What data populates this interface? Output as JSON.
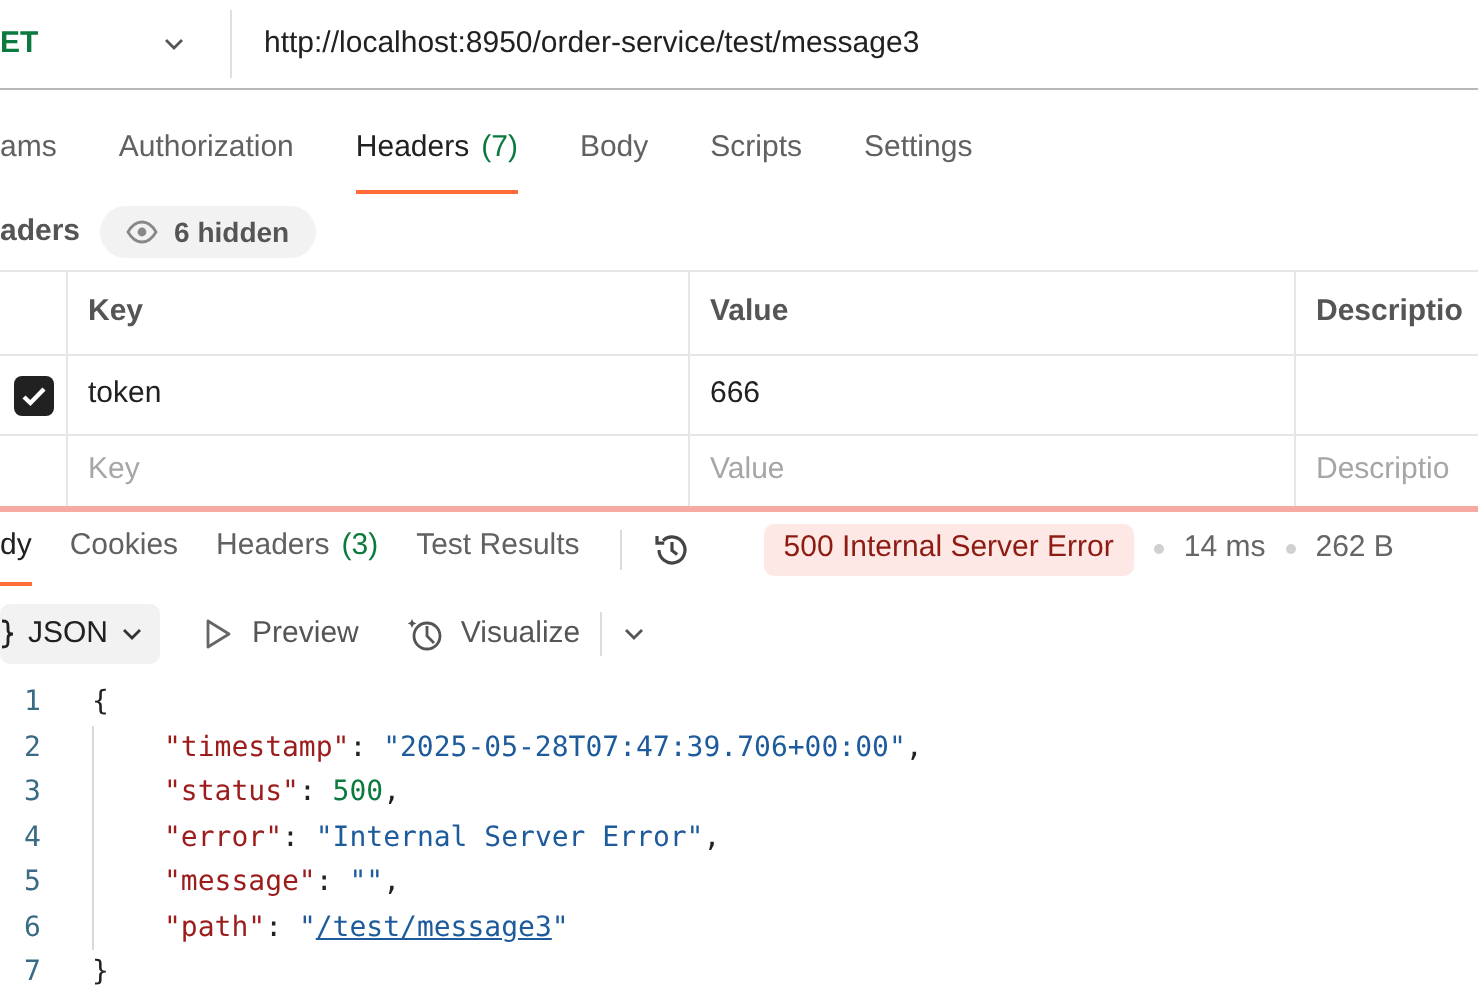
{
  "request": {
    "method": "ET",
    "url": "http://localhost:8950/order-service/test/message3"
  },
  "request_tabs": [
    {
      "label": "ams",
      "selected": false
    },
    {
      "label": "Authorization",
      "selected": false
    },
    {
      "label": "Headers",
      "count": "(7)",
      "selected": true
    },
    {
      "label": "Body",
      "selected": false
    },
    {
      "label": "Scripts",
      "selected": false
    },
    {
      "label": "Settings",
      "selected": false
    }
  ],
  "headers_section": {
    "title": "aders",
    "hidden_toggle": "6 hidden"
  },
  "headers_table": {
    "columns": [
      "Key",
      "Value",
      "Descriptio"
    ],
    "rows": [
      {
        "checked": true,
        "key": "token",
        "value": "666"
      }
    ],
    "new_row": {
      "key_placeholder": "Key",
      "value_placeholder": "Value",
      "description_placeholder": "Descriptio"
    }
  },
  "response_tabs": [
    {
      "label": "dy",
      "selected": true
    },
    {
      "label": "Cookies",
      "selected": false
    },
    {
      "label": "Headers",
      "count": "(3)",
      "selected": false
    },
    {
      "label": "Test Results",
      "selected": false
    }
  ],
  "response_status": {
    "status": "500 Internal Server Error",
    "time": "14 ms",
    "size": "262 B"
  },
  "response_toolbar": {
    "format": "JSON",
    "preview": "Preview",
    "visualize": "Visualize"
  },
  "response_body": [
    {
      "number": "1",
      "tokens": [
        {
          "kind": "punct",
          "text": "{"
        }
      ]
    },
    {
      "number": "2",
      "tokens": [
        {
          "kind": "key",
          "text": "\"timestamp\""
        },
        {
          "kind": "punct",
          "text": ": "
        },
        {
          "kind": "string",
          "text": "\"2025-05-28T07:47:39.706+00:00\""
        },
        {
          "kind": "punct",
          "text": ","
        }
      ]
    },
    {
      "number": "3",
      "tokens": [
        {
          "kind": "key",
          "text": "\"status\""
        },
        {
          "kind": "punct",
          "text": ": "
        },
        {
          "kind": "number",
          "text": "500"
        },
        {
          "kind": "punct",
          "text": ","
        }
      ]
    },
    {
      "number": "4",
      "tokens": [
        {
          "kind": "key",
          "text": "\"error\""
        },
        {
          "kind": "punct",
          "text": ": "
        },
        {
          "kind": "string",
          "text": "\"Internal Server Error\""
        },
        {
          "kind": "punct",
          "text": ","
        }
      ]
    },
    {
      "number": "5",
      "tokens": [
        {
          "kind": "key",
          "text": "\"message\""
        },
        {
          "kind": "punct",
          "text": ": "
        },
        {
          "kind": "string",
          "text": "\"\""
        },
        {
          "kind": "punct",
          "text": ","
        }
      ]
    },
    {
      "number": "6",
      "tokens": [
        {
          "kind": "key",
          "text": "\"path\""
        },
        {
          "kind": "punct",
          "text": ": "
        },
        {
          "kind": "string",
          "text": "\""
        },
        {
          "kind": "link",
          "text": "/test/message3"
        },
        {
          "kind": "string",
          "text": "\""
        }
      ]
    },
    {
      "number": "7",
      "tokens": [
        {
          "kind": "punct",
          "text": "}"
        }
      ]
    }
  ]
}
